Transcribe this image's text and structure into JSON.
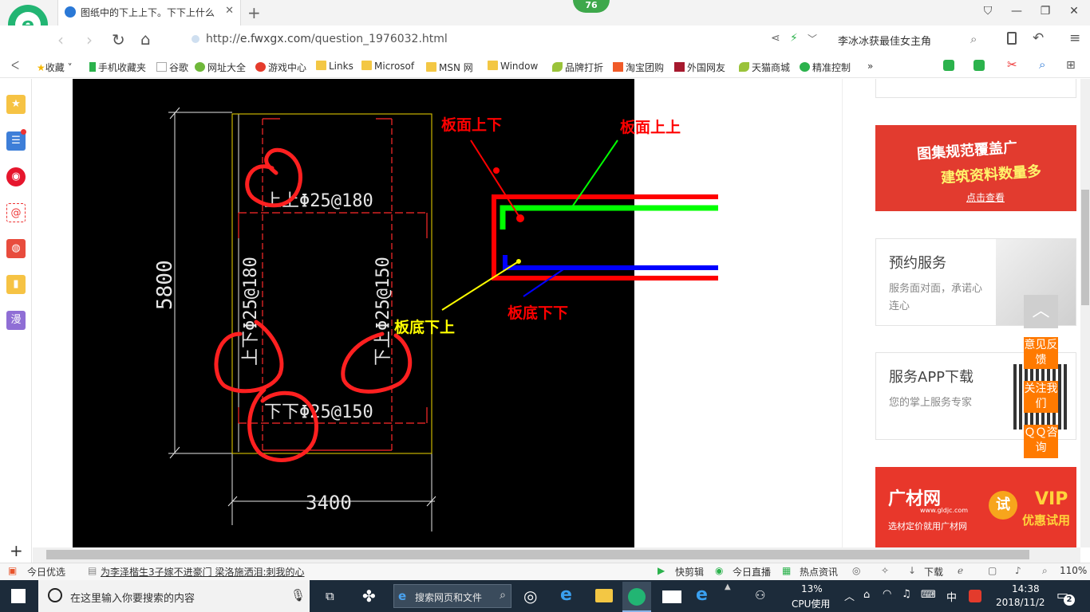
{
  "browser": {
    "tab_title": "图纸中的下上上下。下下上什么",
    "new_tab": "+",
    "badge_count": "76",
    "url_scheme": "http://",
    "url_host": "e.fwxgx.com",
    "url_path": "/question_1976032.html",
    "search_text": "李冰冰获最佳女主角",
    "bookmarks": [
      "收藏",
      "手机收藏夹",
      "谷歌",
      "网址大全",
      "游戏中心",
      "Links",
      "Microsof",
      "MSN 网",
      "Window",
      "品牌打折",
      "淘宝团购",
      "外国网友",
      "天猫商城",
      "精准控制"
    ],
    "more": "»"
  },
  "sidebar": {
    "icons": [
      "star-icon",
      "news-icon",
      "weibo-icon",
      "mail-icon",
      "game-icon",
      "book-icon",
      "manga-icon"
    ],
    "manga_label": "漫",
    "add": "+"
  },
  "drawing": {
    "text_top": "上上Φ25@180",
    "text_left": "上下Φ25@180",
    "text_right": "下上Φ25@150",
    "text_bottom": "下下Φ25@150",
    "dim_height": "5800",
    "dim_width": "3400",
    "label_top_down": "板面上下",
    "label_top_up": "板面上上",
    "label_bottom_up": "板底下上",
    "label_bottom_down": "板底下下",
    "colors": {
      "red": "#ff0000",
      "green": "#00ff00",
      "blue": "#0000ff",
      "yellow": "#ffff00",
      "cad_yellow": "#c8b400"
    }
  },
  "right_panel": {
    "ad1_title": "图集规范覆盖广",
    "ad1_sub": "建筑资料数量多",
    "ad1_btn": "点击查看",
    "card1_title": "预约服务",
    "card1_desc": "服务面对面，承诺心连心",
    "card2_title": "服务APP下载",
    "card2_desc": "您的掌上服务专家",
    "ad2_brand": "广材网",
    "ad2_domain": "www.gldjc.com",
    "ad2_slogan": "选材定价就用广材网",
    "ad2_try": "试",
    "ad2_vip": "VIP",
    "ad2_vip_sub": "优惠试用",
    "float_top": "︿",
    "float_feedback": "意见反馈",
    "float_follow": "关注我们",
    "float_qq": "ＱＱ咨询"
  },
  "status": {
    "today_pick": "今日优选",
    "news": "为李泽楷生3子嫁不进豪门 梁洛施洒泪:刺我的心",
    "quick_clip": "快剪辑",
    "today_live": "今日直播",
    "hot_news": "热点资讯",
    "download": "下载",
    "zoom": "110%"
  },
  "taskbar": {
    "search_placeholder": "在这里输入你要搜索的内容",
    "web_search": "搜索网页和文件",
    "cpu_pct": "13%",
    "cpu_label": "CPU使用",
    "ime": "中",
    "time": "14:38",
    "date": "2018/11/2",
    "notif_count": "2"
  }
}
